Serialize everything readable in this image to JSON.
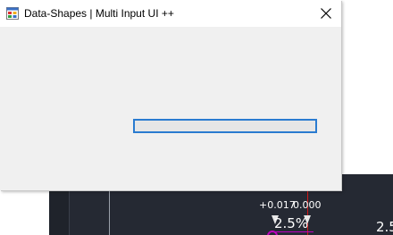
{
  "window": {
    "title": "Data-Shapes | Multi Input UI ++",
    "close_icon": "close-icon"
  },
  "progress": {
    "value": 0
  },
  "background_canvas": {
    "dimension_left": "+0.017",
    "dimension_right": "0.000",
    "slope_center": "2.5%",
    "slope_right": "2.5"
  },
  "colors": {
    "progress_border": "#2a7bd0",
    "dialog_bg": "#f0f0f0",
    "canvas_bg": "#252933"
  }
}
